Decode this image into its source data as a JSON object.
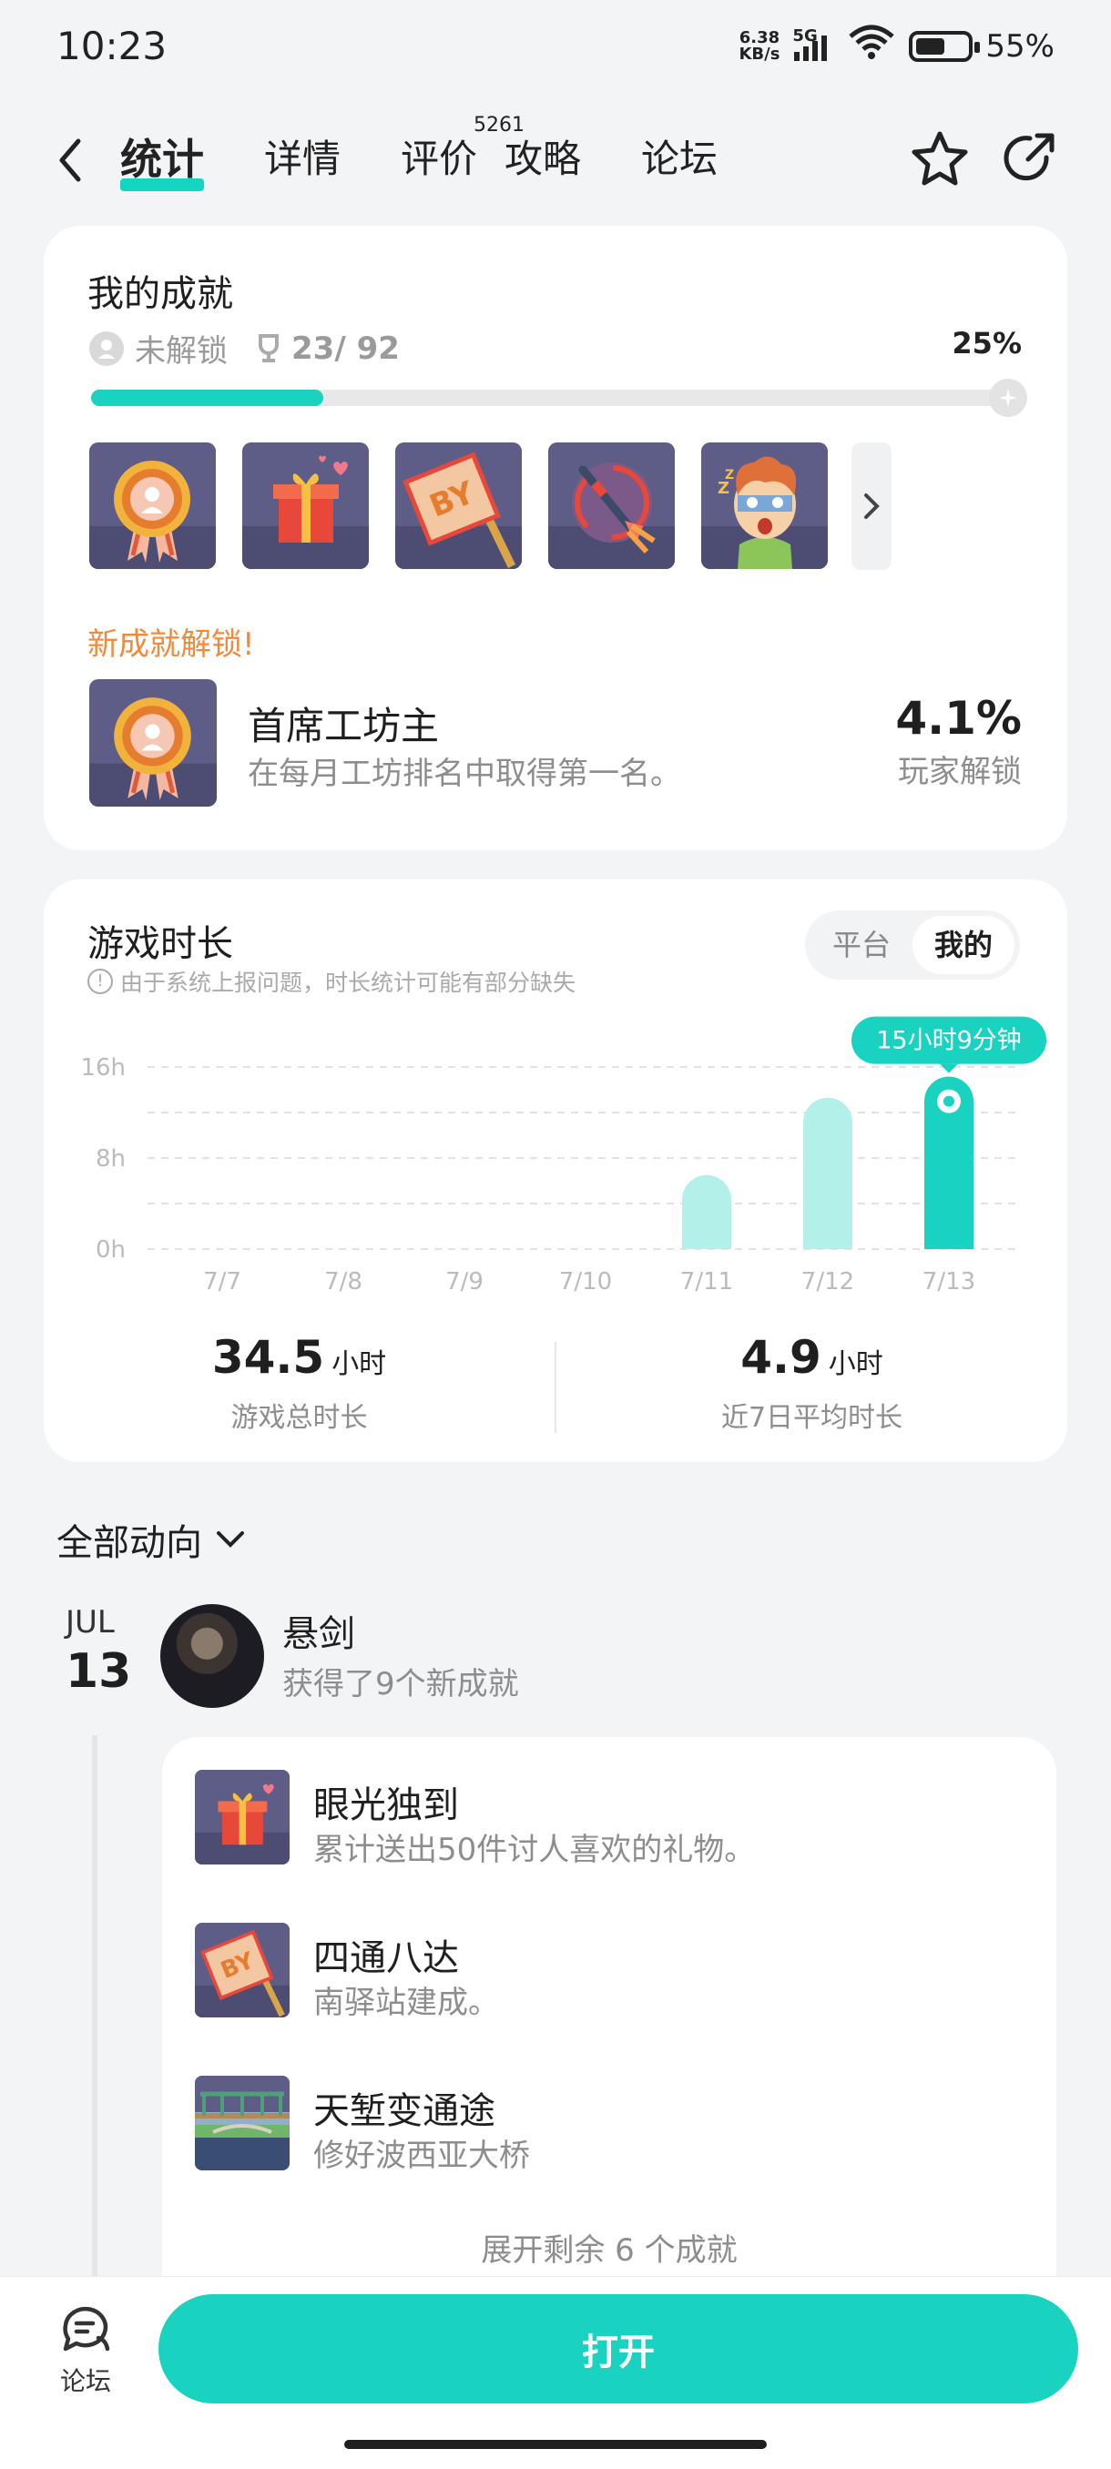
{
  "status": {
    "time": "10:23",
    "net_speed_value": "6.38",
    "net_speed_unit": "KB/s",
    "network": "5G",
    "battery": "55%",
    "battery_level": 0.55
  },
  "nav": {
    "tabs": [
      {
        "label": "统计"
      },
      {
        "label": "详情"
      },
      {
        "label": "评价",
        "badge": "5261"
      },
      {
        "label": "攻略"
      },
      {
        "label": "论坛"
      }
    ],
    "active_tab": 0
  },
  "achievements": {
    "title": "我的成就",
    "locked_label": "未解锁",
    "count": "23/ 92",
    "percent": "25%",
    "progress": 0.25,
    "badges": [
      "medal-icon",
      "gift-icon",
      "sign-icon",
      "dart-icon",
      "face-icon"
    ],
    "new_unlock_label": "新成就解锁!",
    "new_unlock": {
      "name": "首席工坊主",
      "desc": "在每月工坊排名中取得第一名。",
      "percent": "4.1%",
      "percent_label": "玩家解锁"
    }
  },
  "playtime": {
    "title": "游戏时长",
    "toggle": [
      "平台",
      "我的"
    ],
    "note": "由于系统上报问题，时长统计可能有部分缺失",
    "total_value": "34.5",
    "total_unit": "小时",
    "total_label": "游戏总时长",
    "avg_value": "4.9",
    "avg_unit": "小时",
    "avg_label": "近7日平均时长"
  },
  "chart_data": {
    "type": "bar",
    "categories": [
      "7/7",
      "7/8",
      "7/9",
      "7/10",
      "7/11",
      "7/12",
      "7/13"
    ],
    "values": [
      0,
      0,
      0,
      0,
      6.5,
      13.3,
      15.15
    ],
    "y_ticks": [
      "0h",
      "8h",
      "16h"
    ],
    "ylim": [
      0,
      16
    ],
    "tooltip": "15小时9分钟",
    "highlight_index": 6,
    "colors": {
      "bar": "#b3f0ea",
      "highlight": "#19d2c0"
    }
  },
  "activity": {
    "filter": "全部动向",
    "month": "JUL",
    "day": "13",
    "user_name": "悬剑",
    "user_sub": "获得了9个新成就",
    "items": [
      {
        "name": "眼光独到",
        "desc": "累计送出50件讨人喜欢的礼物。",
        "icon": "gift-icon"
      },
      {
        "name": "四通八达",
        "desc": "南驿站建成。",
        "icon": "sign-icon"
      },
      {
        "name": "天堑变通途",
        "desc": "修好波西亚大桥",
        "icon": "bridge-icon"
      }
    ],
    "expand": "展开剩余 6 个成就"
  },
  "bottom": {
    "forum_label": "论坛",
    "open_label": "打开"
  },
  "colors": {
    "accent": "#19d2c0",
    "orange": "#f08a3c"
  }
}
